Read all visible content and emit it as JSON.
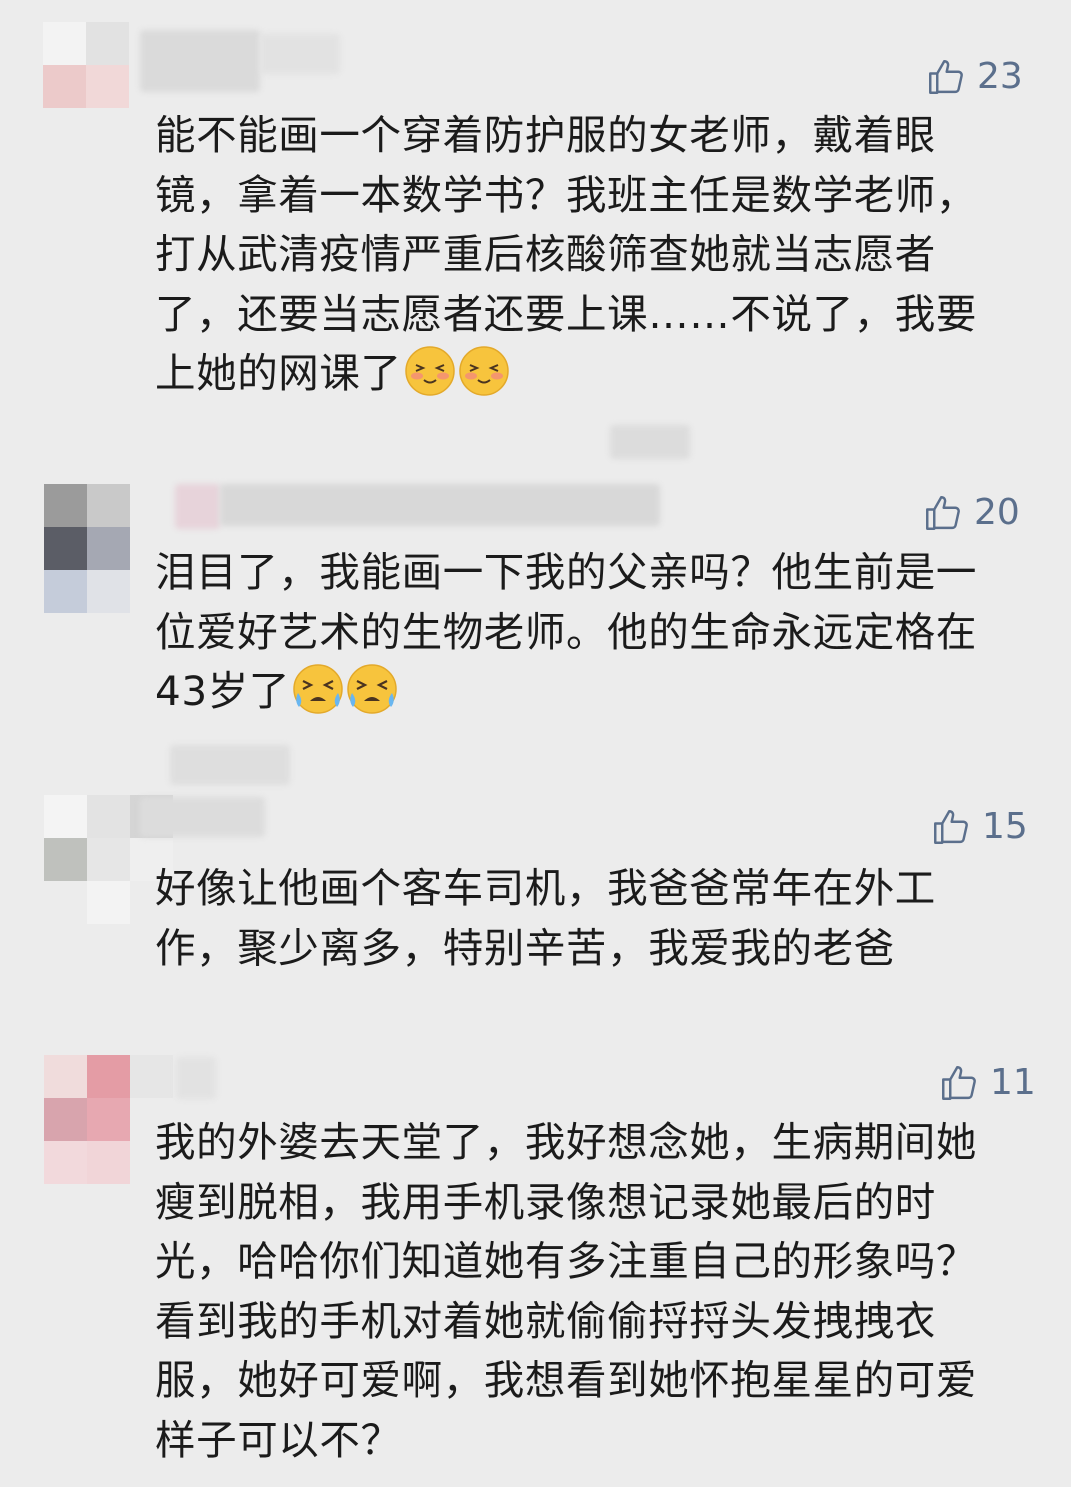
{
  "comments": [
    {
      "likes": "23",
      "text": "能不能画一个穿着防护服的女老师，戴着眼镜，拿着一本数学书？我班主任是数学老师，打从武清疫情严重后核酸筛查她就当志愿者了，还要当志愿者还要上课……不说了，我要上她的网课了",
      "emojis": [
        "shy-emoji",
        "shy-emoji"
      ]
    },
    {
      "likes": "20",
      "text": "泪目了，我能画一下我的父亲吗？他生前是一位爱好艺术的生物老师。他的生命永远定格在43岁了",
      "emojis": [
        "crying-emoji",
        "crying-emoji"
      ]
    },
    {
      "likes": "15",
      "text": "好像让他画个客车司机，我爸爸常年在外工作，聚少离多，特别辛苦，我爱我的老爸",
      "emojis": []
    },
    {
      "likes": "11",
      "text": "我的外婆去天堂了，我好想念她，生病期间她瘦到脱相，我用手机录像想记录她最后的时光，哈哈你们知道她有多注重自己的形象吗？看到我的手机对着她就偷偷捋捋头发拽拽衣服，她好可爱啊，我想看到她怀抱星星的可爱样子可以不？",
      "emojis": []
    }
  ],
  "colors": {
    "background": "#ececec",
    "like_color": "#5b6f8c",
    "text_color": "#1b1b1b"
  },
  "icons": {
    "like": "thumbs-up-icon"
  }
}
